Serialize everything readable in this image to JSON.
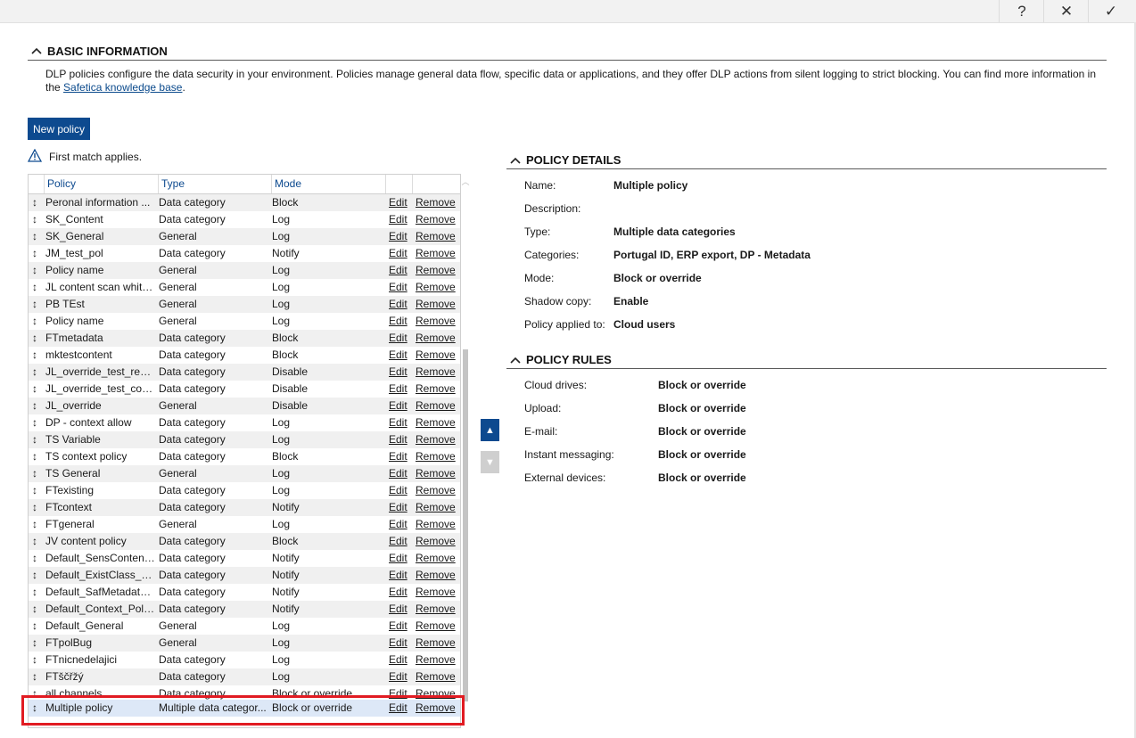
{
  "topbar": {
    "help": "?",
    "close": "✕",
    "confirm": "✓"
  },
  "basic": {
    "title": "BASIC INFORMATION",
    "intro_text": "DLP policies configure the data security in your environment. Policies manage general data flow, specific data or applications, and they offer DLP actions from silent logging to strict blocking. You can find more information in the",
    "intro_link": "Safetica knowledge base",
    "intro_end": "."
  },
  "new_policy_label": "New policy",
  "first_match_note": "First match applies.",
  "grid": {
    "columns": [
      "Policy",
      "Type",
      "Mode"
    ],
    "edit_label": "Edit",
    "remove_label": "Remove",
    "rows": [
      [
        "Peronal information ...",
        "Data category",
        "Block"
      ],
      [
        "SK_Content",
        "Data category",
        "Log"
      ],
      [
        "SK_General",
        "General",
        "Log"
      ],
      [
        "JM_test_pol",
        "Data category",
        "Notify"
      ],
      [
        "Policy name",
        "General",
        "Log"
      ],
      [
        "JL content scan white...",
        "General",
        "Log"
      ],
      [
        "PB TEst",
        "General",
        "Log"
      ],
      [
        "Policy name",
        "General",
        "Log"
      ],
      [
        "FTmetadata",
        "Data category",
        "Block"
      ],
      [
        "mktestcontent",
        "Data category",
        "Block"
      ],
      [
        "JL_override_test_restri...",
        "Data category",
        "Disable"
      ],
      [
        "JL_override_test_cont...",
        "Data category",
        "Disable"
      ],
      [
        "JL_override",
        "General",
        "Disable"
      ],
      [
        "DP - context allow",
        "Data category",
        "Log"
      ],
      [
        "TS Variable",
        "Data category",
        "Log"
      ],
      [
        "TS context policy",
        "Data category",
        "Block"
      ],
      [
        "TS General",
        "General",
        "Log"
      ],
      [
        "FTexisting",
        "Data category",
        "Log"
      ],
      [
        "FTcontext",
        "Data category",
        "Notify"
      ],
      [
        "FTgeneral",
        "General",
        "Log"
      ],
      [
        "JV content policy",
        "Data category",
        "Block"
      ],
      [
        "Default_SensContent...",
        "Data category",
        "Notify"
      ],
      [
        "Default_ExistClass_Po...",
        "Data category",
        "Notify"
      ],
      [
        "Default_SafMetadata_...",
        "Data category",
        "Notify"
      ],
      [
        "Default_Context_Policy",
        "Data category",
        "Notify"
      ],
      [
        "Default_General",
        "General",
        "Log"
      ],
      [
        "FTpolBug",
        "General",
        "Log"
      ],
      [
        "FTnicnedelajici",
        "Data category",
        "Log"
      ],
      [
        "FTščřžý",
        "Data category",
        "Log"
      ],
      [
        "all channels",
        "Data category",
        "Block or override"
      ]
    ],
    "selected": [
      "Multiple policy",
      "Multiple data categor...",
      "Block or override"
    ]
  },
  "details": {
    "title": "POLICY DETAILS",
    "fields": [
      [
        "Name:",
        "Multiple policy"
      ],
      [
        "Description:",
        ""
      ],
      [
        "Type:",
        "Multiple data categories"
      ],
      [
        "Categories:",
        "Portugal ID, ERP export, DP - Metadata"
      ],
      [
        "Mode:",
        "Block or override"
      ],
      [
        "Shadow copy:",
        "Enable"
      ],
      [
        "Policy applied to:",
        "Cloud users"
      ]
    ]
  },
  "rules": {
    "title": "POLICY RULES",
    "fields": [
      [
        "Cloud drives:",
        "Block or override"
      ],
      [
        "Upload:",
        "Block or override"
      ],
      [
        "E-mail:",
        "Block or override"
      ],
      [
        "Instant messaging:",
        "Block or override"
      ],
      [
        "External devices:",
        "Block or override"
      ]
    ]
  },
  "move": {
    "up": "▲",
    "down": "▼"
  }
}
